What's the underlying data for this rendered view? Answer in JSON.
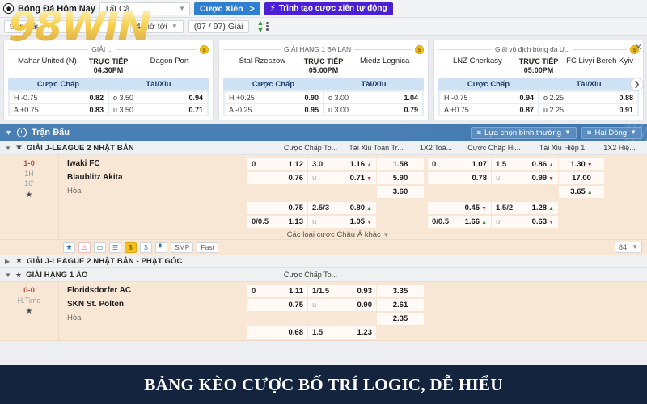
{
  "toolbar": {
    "ball_icon": "soccer-ball-icon",
    "title": "Bóng Đá Hôm Nay",
    "filter_all": "Tất Cả",
    "parlay_label": "Cược Xiên",
    "parlay_arrow": ">",
    "auto_parlay_label": "Trình tạo cược xiên tự động",
    "bolt_icon": "lightning-icon"
  },
  "filterbar": {
    "match_filter": "trận đấu",
    "hours": "4 giờ tới",
    "leagues_count": "(97 / 97) Giải",
    "sort_icon": "sort-icon"
  },
  "cards": [
    {
      "league": "GIẢI ...",
      "home": "Mahar United (N)",
      "away": "Dagon Port",
      "live": "TRỰC TIẾP",
      "time": "04:30PM",
      "col1": "Cược Chấp",
      "col2": "Tài/Xỉu",
      "rows": [
        {
          "k1": "H -0.75",
          "v1": "0.82",
          "k2": "o 3.50",
          "v2": "0.94"
        },
        {
          "k1": "A +0.75",
          "v1": "0.83",
          "k2": "u 3.50",
          "v2": "0.71"
        }
      ]
    },
    {
      "league": "GIẢI HẠNG 1 BA LAN",
      "home": "Stal Rzeszow",
      "away": "Miedz Legnica",
      "live": "TRỰC TIẾP",
      "time": "05:00PM",
      "col1": "Cược Chấp",
      "col2": "Tài/Xỉu",
      "rows": [
        {
          "k1": "H +0.25",
          "v1": "0.90",
          "k2": "o 3.00",
          "v2": "1.04"
        },
        {
          "k1": "A -0.25",
          "v1": "0.95",
          "k2": "u 3.00",
          "v2": "0.79"
        }
      ]
    },
    {
      "league": "Giải vô địch bóng đá U...",
      "home": "LNZ Cherkasy",
      "away": "FC Livyi Bereh Kyiv",
      "live": "TRỰC TIẾP",
      "time": "05:00PM",
      "col1": "Cược Chấp",
      "col2": "Tài/Xỉu",
      "rows": [
        {
          "k1": "H -0.75",
          "v1": "0.94",
          "k2": "o 2.25",
          "v2": "0.88"
        },
        {
          "k1": "A +0.75",
          "v1": "0.87",
          "k2": "u 2.25",
          "v2": "0.91"
        }
      ]
    }
  ],
  "strip": {
    "next_icon": "chevron-right-icon",
    "close_icon": "close-icon"
  },
  "bluebar": {
    "clock_icon": "clock-icon",
    "title": "Trận Đấu",
    "view_option": "Lựa chọn bình thường",
    "rows_option": "Hai Dòng"
  },
  "columns": [
    "Cược Chấp To...",
    "Tài Xỉu Toàn Tr...",
    "1X2 Toà...",
    "Cược Chấp Hi...",
    "Tài Xỉu Hiệp 1",
    "1X2 Hiệ..."
  ],
  "leagues": [
    {
      "name": "GIẢI J-LEAGUE 2 NHẬT BẢN",
      "expanded": true
    },
    {
      "name": "GIẢI J-LEAGUE 2 NHẬT BẢN - PHẠT GÓC",
      "expanded": false
    },
    {
      "name": "GIẢI HẠNG 1 ÁO",
      "expanded": true
    }
  ],
  "matches": [
    {
      "score": "1-0",
      "period": "1H",
      "minute": "16'",
      "home": "Iwaki FC",
      "away": "Blaublitz Akita",
      "draw": "Hòa",
      "ft": {
        "ah": [
          {
            "k": "0",
            "v": "1.12"
          },
          {
            "k": "",
            "v": "0.76"
          }
        ],
        "ou": [
          {
            "k": "3.0",
            "v": "1.16",
            "arrow": "up"
          },
          {
            "k": "u",
            "v": "0.71",
            "arrow": "dn"
          }
        ],
        "x12": [
          {
            "v": "1.58"
          },
          {
            "v": "5.90"
          },
          {
            "v": "3.60"
          }
        ]
      },
      "h1": {
        "ah": [
          {
            "k": "0",
            "v": "1.07"
          },
          {
            "k": "",
            "v": "0.78"
          }
        ],
        "ou": [
          {
            "k": "1.5",
            "v": "0.86",
            "arrow": "up"
          },
          {
            "k": "u",
            "v": "0.99",
            "arrow": "dn"
          }
        ],
        "x12": [
          {
            "v": "1.30",
            "arrow": "dn"
          },
          {
            "v": "17.00"
          },
          {
            "v": "3.65",
            "arrow": "up"
          }
        ]
      },
      "ft2": {
        "ah": [
          {
            "k": "",
            "v": "0.75"
          },
          {
            "k": "0/0.5",
            "v": "1.13"
          }
        ],
        "ou": [
          {
            "k": "2.5/3",
            "v": "0.80",
            "arrow": "up"
          },
          {
            "k": "u",
            "v": "1.05",
            "arrow": "dn"
          }
        ]
      },
      "h12": {
        "ah": [
          {
            "k": "",
            "v": "0.45",
            "arrow": "dn"
          },
          {
            "k": "0/0.5",
            "v": "1.66",
            "arrow": "up"
          }
        ],
        "ou": [
          {
            "k": "1.5/2",
            "v": "1.28",
            "arrow": "up"
          },
          {
            "k": "u",
            "v": "0.63",
            "arrow": "dn"
          }
        ]
      },
      "asian_more": "Các loại cược Châu Á khác",
      "icons": [
        "star-icon",
        "fire-icon",
        "video-icon",
        "stats-icon",
        "coin-icon",
        "dollar-icon",
        "chart-icon"
      ],
      "icon_texts": [
        "SMP",
        "Fast"
      ],
      "pager": "84"
    },
    {
      "score": "0-0",
      "period": "H.Time",
      "minute": "",
      "home": "Floridsdorfer AC",
      "away": "SKN St. Polten",
      "draw": "Hòa",
      "ft": {
        "ah": [
          {
            "k": "0",
            "v": "1.11"
          },
          {
            "k": "",
            "v": "0.75"
          }
        ],
        "ou": [
          {
            "k": "1/1.5",
            "v": "0.93"
          },
          {
            "k": "u",
            "v": "0.90"
          }
        ],
        "x12": [
          {
            "v": "3.35"
          },
          {
            "v": "2.61"
          },
          {
            "v": "2.35"
          }
        ]
      },
      "ft2": {
        "ah": [
          {
            "k": "",
            "v": "0.68"
          }
        ],
        "ou": [
          {
            "k": "1.5",
            "v": "1.23"
          }
        ]
      }
    }
  ],
  "banner": {
    "text": "BẢNG KÈO CƯỢC BỐ TRÍ LOGIC, DỄ HIỂU"
  },
  "watermark": {
    "text": "98WIN"
  }
}
